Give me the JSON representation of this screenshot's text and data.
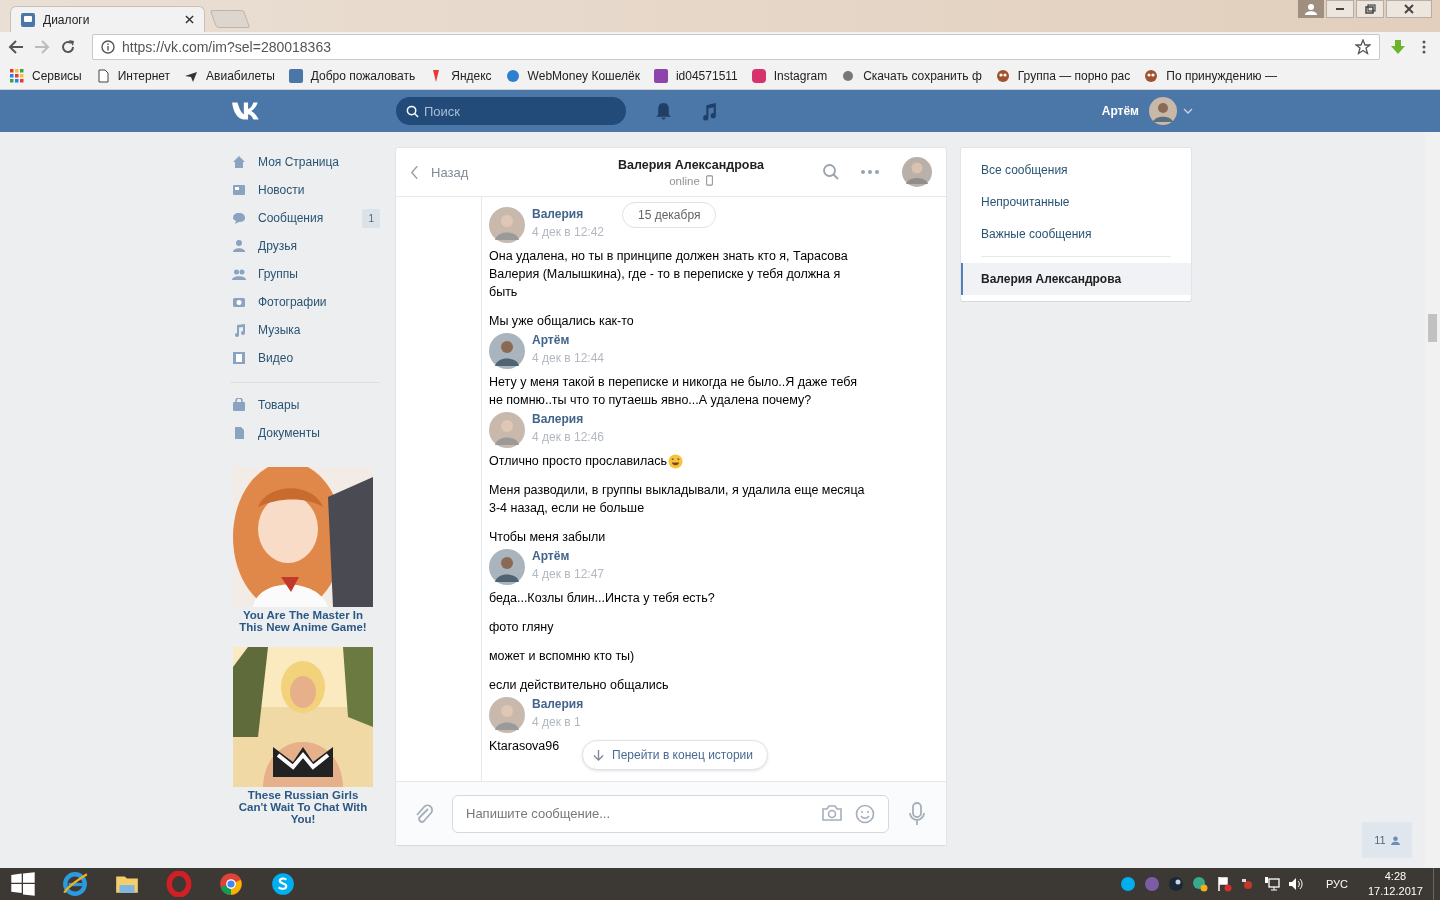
{
  "browser": {
    "tabs": [
      {
        "title": "Диалоги",
        "selected": true
      }
    ],
    "url": "https://vk.com/im?sel=280018363",
    "bookmarks": [
      "Сервисы",
      "Интернет",
      "Авиабилеты",
      "Добро пожаловать",
      "Яндекс",
      "WebMoney Кошелёк",
      "id04571511",
      "Instagram",
      "Скачать сохранить ф",
      "Группа — порно рас",
      "По принуждению —"
    ]
  },
  "header": {
    "search_placeholder": "Поиск",
    "user_name": "Артём"
  },
  "nav": {
    "groups": [
      [
        {
          "label": "Моя Страница"
        },
        {
          "label": "Новости"
        },
        {
          "label": "Сообщения",
          "counter": "1"
        },
        {
          "label": "Друзья"
        },
        {
          "label": "Группы"
        },
        {
          "label": "Фотографии"
        },
        {
          "label": "Музыка"
        },
        {
          "label": "Видео"
        }
      ],
      [
        {
          "label": "Товары"
        },
        {
          "label": "Документы"
        }
      ]
    ]
  },
  "ads": [
    {
      "kind": "picture",
      "caption": "You Are The Master In This New Anime Game!"
    },
    {
      "kind": "picture",
      "caption": "These Russian Girls Can't Wait To Chat With You!"
    }
  ],
  "chat": {
    "back": "Назад",
    "title": "Валерия Александрова",
    "status": "online",
    "date_pill": "15 декабря",
    "messages": [
      {
        "author": "Валерия",
        "time": "4 дек в 12:42",
        "texts": [
          "Она удалена, но ты в принципе должен знать кто я, Тарасова Валерия (Малышкина), где - то в переписке у тебя должна я быть",
          "Мы уже общались как-то"
        ]
      },
      {
        "author": "Артём",
        "time": "4 дек в 12:44",
        "texts": [
          "Нету у меня такой в переписке и никогда не было..Я даже тебя не помню..ты что то путаешь явно...А удалена почему?"
        ]
      },
      {
        "author": "Валерия",
        "time": "4 дек в 12:46",
        "texts": [
          "Отлично просто прославилась",
          "Меня разводили, в группы выкладывали, я удалила еще месяца 3-4 назад, если не больше",
          "Чтобы меня забыли"
        ]
      },
      {
        "author": "Артём",
        "time": "4 дек в 12:47",
        "texts": [
          "беда...Козлы блин...Инста у тебя есть?",
          "фото гляну",
          "может и вспомню кто ты)",
          "если действительно общались"
        ]
      },
      {
        "author": "Валерия",
        "time": "4 дек в 1",
        "texts": [
          "Ktarasova96"
        ]
      }
    ],
    "jump_button": "Перейти в конец истории",
    "input_placeholder": "Напишите сообщение..."
  },
  "right_menu": {
    "filters": [
      {
        "label": "Все сообщения",
        "selected": false
      },
      {
        "label": "Непрочитанные",
        "selected": false
      },
      {
        "label": "Важные сообщения",
        "selected": false
      }
    ],
    "conversations": [
      {
        "label": "Валерия Александрова",
        "selected": true
      }
    ]
  },
  "corner_badge": "11",
  "taskbar": {
    "language": "РУС",
    "time": "4:28",
    "date": "17.12.2017"
  }
}
